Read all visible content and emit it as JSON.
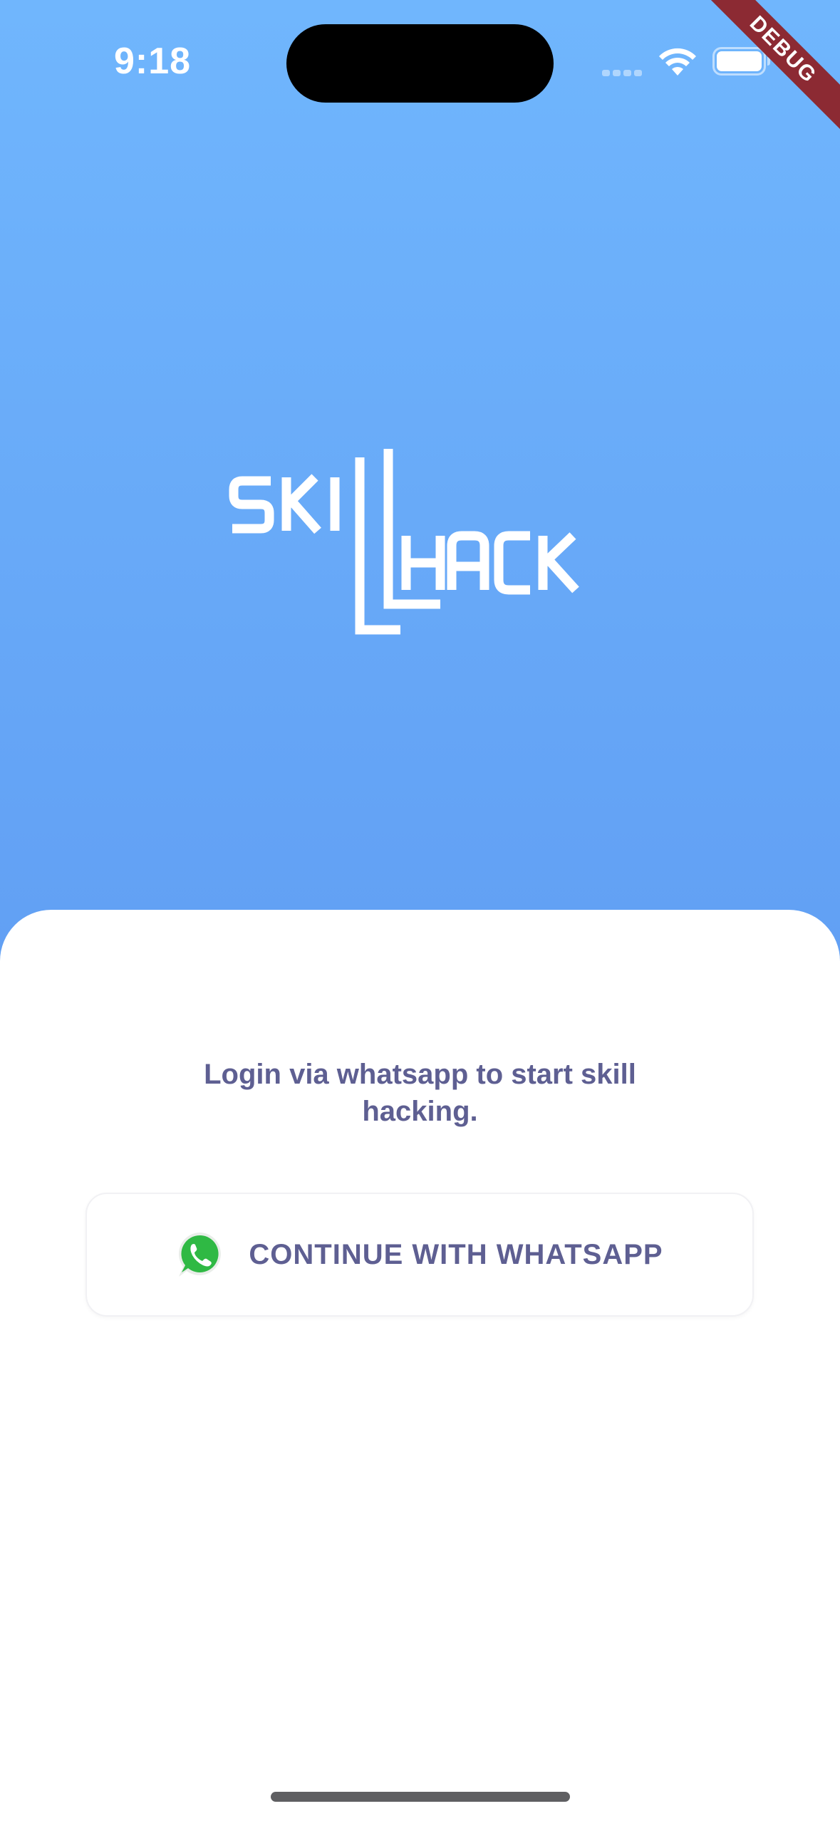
{
  "status_bar": {
    "time": "9:18",
    "debug_label": "DEBUG"
  },
  "logo": {
    "text": "SKILLHACK",
    "color": "#ffffff"
  },
  "login_sheet": {
    "prompt": "Login via whatsapp to start skill hacking.",
    "whatsapp_button_label": "CONTINUE WITH WHATSAPP",
    "text_color": "#5e5f92"
  },
  "icons": {
    "wifi": "wifi-icon",
    "battery": "battery-icon",
    "signal": "cellular-signal-icon",
    "whatsapp": "whatsapp-icon"
  },
  "colors": {
    "gradient_top": "#70b6fd",
    "gradient_bottom": "#5a93ee",
    "whatsapp_green": "#2fb944",
    "debug_ribbon": "#8c2a33"
  }
}
